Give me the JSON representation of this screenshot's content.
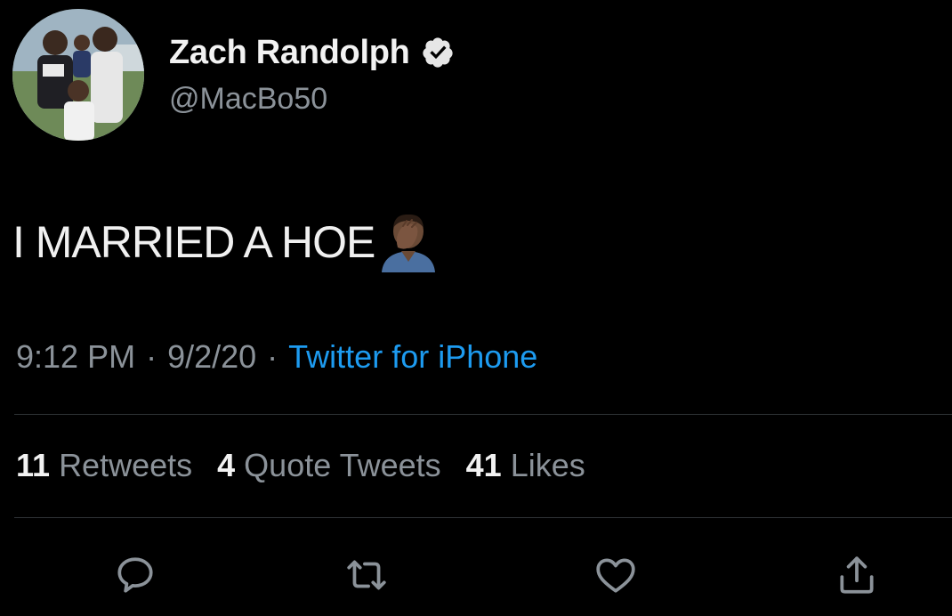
{
  "tweet": {
    "author": {
      "display_name": "Zach Randolph",
      "handle": "@MacBo50",
      "verified": true
    },
    "text": "I MARRIED A HOE",
    "emoji": "facepalm-emoji",
    "meta": {
      "time": "9:12 PM",
      "separator": "·",
      "date": "9/2/20",
      "source": "Twitter for iPhone"
    },
    "stats": {
      "retweets": {
        "count": "11",
        "label": "Retweets"
      },
      "quote_tweets": {
        "count": "4",
        "label": "Quote Tweets"
      },
      "likes": {
        "count": "41",
        "label": "Likes"
      }
    },
    "actions": [
      {
        "icon": "reply-icon"
      },
      {
        "icon": "retweet-icon"
      },
      {
        "icon": "like-icon"
      },
      {
        "icon": "share-icon"
      }
    ]
  },
  "colors": {
    "background": "#000000",
    "primary_text": "#f2f2f2",
    "secondary_text": "#8b9299",
    "accent": "#1d9bf0",
    "divider": "#2f3336"
  }
}
